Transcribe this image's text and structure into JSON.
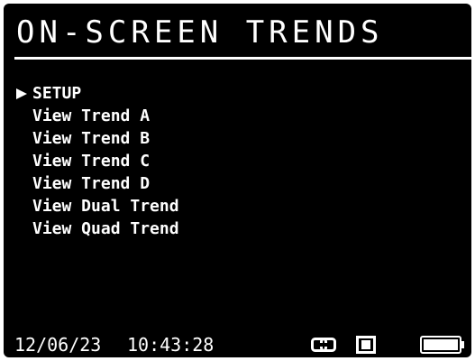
{
  "header": {
    "title": "ON-SCREEN TRENDS"
  },
  "menu": {
    "selected_index": 0,
    "items": [
      {
        "label": "SETUP"
      },
      {
        "label": "View Trend A"
      },
      {
        "label": "View Trend B"
      },
      {
        "label": "View Trend C"
      },
      {
        "label": "View Trend D"
      },
      {
        "label": "View Dual Trend"
      },
      {
        "label": "View Quad Trend"
      }
    ]
  },
  "status": {
    "date": "12/06/23",
    "time": "10:43:28",
    "icons": [
      "link-icon",
      "record-icon",
      "battery-icon"
    ],
    "battery_level": 1.0
  },
  "colors": {
    "screen_background": "#000000",
    "foreground": "#ffffff",
    "bezel": "#ffffff"
  }
}
